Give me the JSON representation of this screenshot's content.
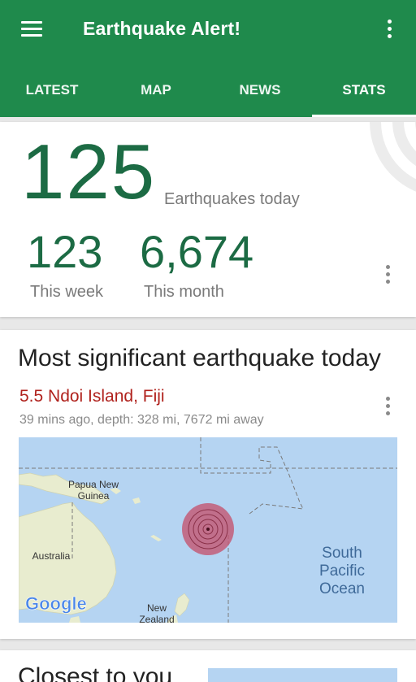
{
  "app": {
    "title": "Earthquake Alert!",
    "tabs": [
      {
        "label": "LATEST",
        "active": false
      },
      {
        "label": "MAP",
        "active": false
      },
      {
        "label": "NEWS",
        "active": false
      },
      {
        "label": "STATS",
        "active": true
      }
    ]
  },
  "colors": {
    "appbar": "#1f8a4c",
    "stat_numbers": "#1c6b44",
    "quake_name": "#b0221d",
    "ocean": "#b5d4f2"
  },
  "icons": [
    "menu-icon",
    "overflow-menu-icon",
    "rings-logo-icon",
    "epicenter-icon"
  ],
  "stats": {
    "today_count": "125",
    "today_label": "Earthquakes today",
    "week_count": "123",
    "week_label": "This week",
    "month_count": "6,674",
    "month_label": "This month"
  },
  "significant": {
    "heading": "Most significant earthquake today",
    "quake": "5.5 Ndoi Island, Fiji",
    "meta": "39 mins ago, depth: 328 mi, 7672 mi away",
    "map_labels": {
      "papua_1": "Papua New",
      "papua_2": "Guinea",
      "australia": "Australia",
      "nz_1": "New",
      "nz_2": "Zealand",
      "ocean_1": "South",
      "ocean_2": "Pacific",
      "ocean_3": "Ocean",
      "attribution": "Google"
    }
  },
  "closest": {
    "heading": "Closest to you"
  }
}
